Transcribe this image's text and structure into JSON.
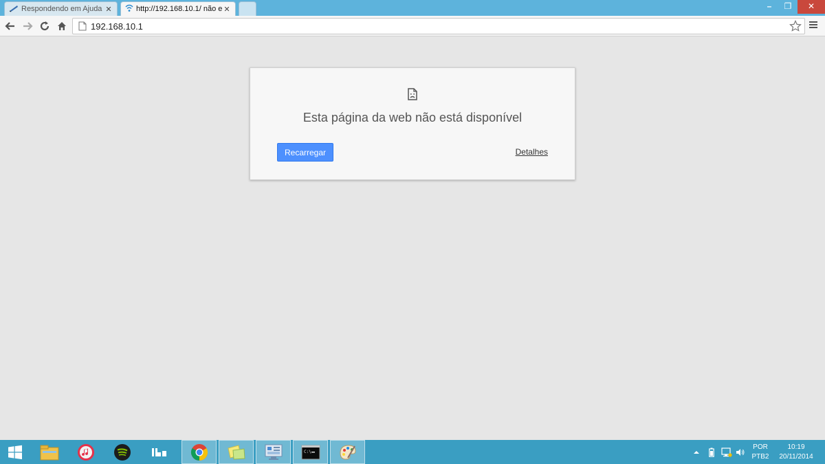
{
  "browser": {
    "tabs": [
      {
        "label": "Respondendo em Ajuda p",
        "active": false
      },
      {
        "label": "http://192.168.10.1/ não e",
        "active": true
      }
    ],
    "address": "192.168.10.1"
  },
  "error_page": {
    "heading": "Esta página da web não está disponível",
    "reload_label": "Recarregar",
    "details_label": "Detalhes"
  },
  "taskbar": {
    "language": "POR",
    "keyboard_layout": "PTB2",
    "time": "10:19",
    "date": "20/11/2014",
    "apps": [
      "file-explorer",
      "itunes",
      "spotify",
      "ibe",
      "chrome",
      "sticky-notes",
      "control-panel",
      "command-prompt",
      "paint"
    ]
  },
  "colors": {
    "tabstrip": "#5db3dc",
    "taskbar": "#3a9ec2",
    "reload_button": "#4d90fe",
    "page_background": "#e6e6e6"
  }
}
